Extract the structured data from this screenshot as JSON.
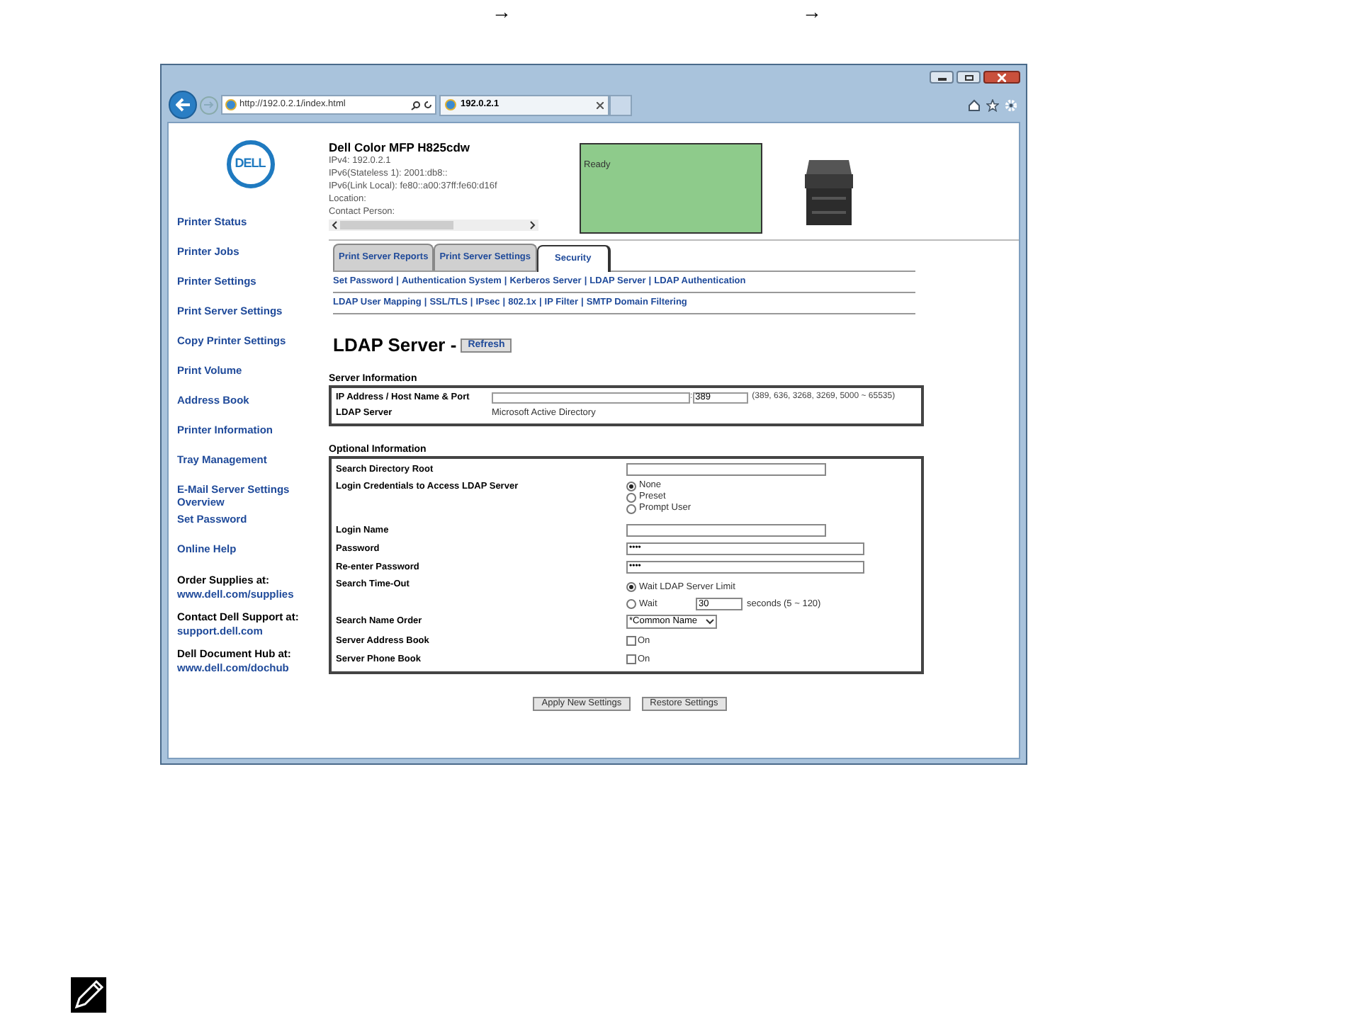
{
  "page_arrows": [
    "→",
    "→"
  ],
  "browser": {
    "address": "http://192.0.2.1/index.html",
    "tab_title": "192.0.2.1"
  },
  "logo_text": "DELL",
  "sidebar": {
    "items": [
      "Printer Status",
      "Printer Jobs",
      "Printer Settings",
      "Print Server Settings",
      "Copy Printer Settings",
      "Print Volume",
      "Address Book",
      "Printer Information",
      "Tray Management",
      "E-Mail Server Settings Overview",
      "Set Password",
      "Online Help"
    ],
    "contacts": [
      {
        "label": "Order Supplies at:",
        "link": "www.dell.com/supplies"
      },
      {
        "label": "Contact Dell Support at:",
        "link": "support.dell.com"
      },
      {
        "label": "Dell Document Hub at:",
        "link": "www.dell.com/dochub"
      }
    ]
  },
  "printer": {
    "model": "Dell Color MFP H825cdw",
    "info": [
      "IPv4: 192.0.2.1",
      "IPv6(Stateless 1): 2001:db8::",
      "IPv6(Link Local): fe80::a00:37ff:fe60:d16f",
      "Location:",
      "Contact Person:"
    ],
    "status": "Ready"
  },
  "tabs": [
    {
      "label": "Print Server Reports",
      "selected": false
    },
    {
      "label": "Print Server Settings",
      "selected": false
    },
    {
      "label": "Security",
      "selected": true
    }
  ],
  "link_separator": "|",
  "link_rows": [
    [
      "Set Password",
      "Authentication System",
      "Kerberos Server",
      "LDAP Server",
      "LDAP Authentication"
    ],
    [
      "LDAP User Mapping",
      "SSL/TLS",
      "IPsec",
      "802.1x",
      "IP Filter",
      "SMTP Domain Filtering"
    ]
  ],
  "page_title": "LDAP Server -",
  "refresh_button": "Refresh",
  "server_information": {
    "heading": "Server Information",
    "rows": [
      {
        "kind": "address",
        "label": "IP Address / Host Name & Port",
        "separator": ":",
        "port": "389",
        "range": "(389, 636, 3268, 3269, 5000 ~ 65535)"
      },
      {
        "kind": "text",
        "label": "LDAP Server",
        "value": "Microsoft Active Directory"
      }
    ]
  },
  "optional_information": {
    "heading": "Optional Information",
    "rows": [
      {
        "kind": "input",
        "label": "Search Directory Root"
      },
      {
        "kind": "radios",
        "label": "Login Credentials to Access LDAP Server",
        "options": [
          {
            "label": "None",
            "selected": true
          },
          {
            "label": "Preset",
            "selected": false
          },
          {
            "label": "Prompt User",
            "selected": false
          }
        ]
      },
      {
        "kind": "input",
        "label": "Login Name"
      },
      {
        "kind": "password",
        "label": "Password",
        "value": "••••"
      },
      {
        "kind": "password",
        "label": "Re-enter Password",
        "value": "••••"
      },
      {
        "kind": "timeout",
        "label": "Search Time-Out",
        "options": [
          {
            "label": "Wait LDAP Server Limit",
            "selected": true
          },
          {
            "label": "Wait",
            "selected": false,
            "value": "30",
            "hint": "seconds (5 ~ 120)"
          }
        ]
      },
      {
        "kind": "select",
        "label": "Search Name Order",
        "value": "*Common Name"
      },
      {
        "kind": "checkbox",
        "label": "Server Address Book",
        "option": "On",
        "checked": false
      },
      {
        "kind": "checkbox",
        "label": "Server Phone Book",
        "option": "On",
        "checked": false
      }
    ]
  },
  "buttons": [
    "Apply New Settings",
    "Restore Settings"
  ]
}
